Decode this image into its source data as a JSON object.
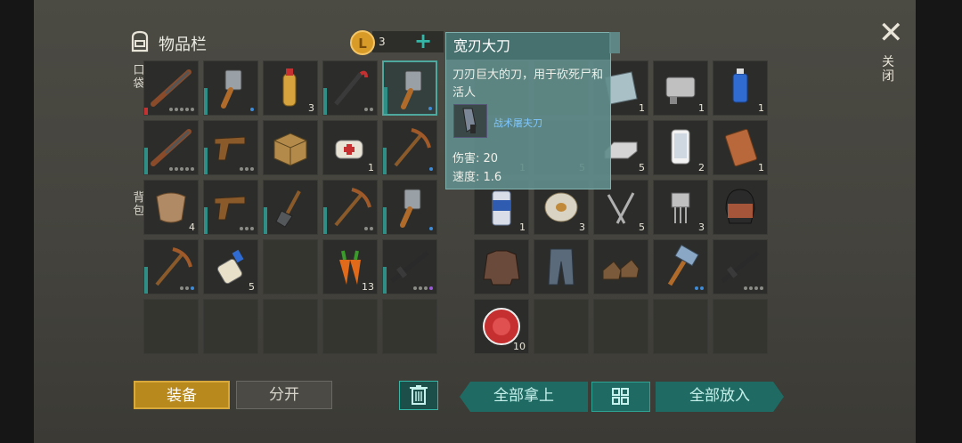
{
  "header": {
    "title": "物品栏",
    "coins": "3",
    "plus_label": "+"
  },
  "side_labels": {
    "pockets": "口袋",
    "backpack": "背包",
    "close": "关闭"
  },
  "close_icon": "✕",
  "colors": {
    "accent": "#35b7a7",
    "equip_gold": "#b88a1d",
    "durability_red": "#c43333"
  },
  "left_cells": [
    {
      "icon": "shotgun-icon",
      "count": "",
      "dots": "gray5",
      "bar": "red"
    },
    {
      "icon": "cleaver-icon",
      "count": "",
      "dots": "b1",
      "bar": "teal"
    },
    {
      "icon": "bottle-icon",
      "count": "3",
      "dots": "",
      "bar": "none"
    },
    {
      "icon": "crowbar-icon",
      "count": "",
      "dots": "gray2",
      "bar": "teal"
    },
    {
      "icon": "cleaver-icon",
      "count": "",
      "dots": "b1",
      "bar": "teal",
      "selected": true
    },
    {
      "icon": "shotgun-icon",
      "count": "",
      "dots": "gray5",
      "bar": "teal"
    },
    {
      "icon": "pistol-icon",
      "count": "",
      "dots": "gray3",
      "bar": "teal"
    },
    {
      "icon": "box-icon",
      "count": "",
      "dots": "",
      "bar": "none"
    },
    {
      "icon": "medkit-icon",
      "count": "1",
      "dots": "",
      "bar": "none"
    },
    {
      "icon": "pickaxe-icon",
      "count": "",
      "dots": "b1",
      "bar": "teal"
    },
    {
      "icon": "hide-icon",
      "count": "4",
      "dots": "",
      "bar": "none"
    },
    {
      "icon": "pistol-icon",
      "count": "",
      "dots": "gray3",
      "bar": "teal"
    },
    {
      "icon": "shovel-icon",
      "count": "",
      "dots": "",
      "bar": "teal"
    },
    {
      "icon": "pickaxe-icon",
      "count": "",
      "dots": "gray2",
      "bar": "teal"
    },
    {
      "icon": "cleaver-icon",
      "count": "",
      "dots": "b1",
      "bar": "teal"
    },
    {
      "icon": "pickaxe-icon",
      "count": "",
      "dots": "gray2b",
      "bar": "teal"
    },
    {
      "icon": "glue-icon",
      "count": "5",
      "dots": "",
      "bar": "none"
    },
    {
      "icon": "",
      "count": "",
      "dots": "",
      "bar": "none"
    },
    {
      "icon": "carrot-icon",
      "count": "13",
      "dots": "",
      "bar": "none"
    },
    {
      "icon": "rifle-icon",
      "count": "",
      "dots": "gray3p",
      "bar": "teal"
    },
    {
      "icon": "",
      "count": "",
      "dots": "",
      "bar": "none"
    },
    {
      "icon": "",
      "count": "",
      "dots": "",
      "bar": "none"
    },
    {
      "icon": "",
      "count": "",
      "dots": "",
      "bar": "none"
    },
    {
      "icon": "",
      "count": "",
      "dots": "",
      "bar": "none"
    },
    {
      "icon": "",
      "count": "",
      "dots": "",
      "bar": "none"
    }
  ],
  "right_cells": [
    {
      "icon": "",
      "count": ""
    },
    {
      "icon": "",
      "count": ""
    },
    {
      "icon": "glass-icon",
      "count": "1"
    },
    {
      "icon": "engine-icon",
      "count": "1"
    },
    {
      "icon": "spray-icon",
      "count": "1"
    },
    {
      "icon": "",
      "count": "1"
    },
    {
      "icon": "",
      "count": "5"
    },
    {
      "icon": "ingot-icon",
      "count": "5"
    },
    {
      "icon": "phone-icon",
      "count": "2"
    },
    {
      "icon": "diary-icon",
      "count": "1"
    },
    {
      "icon": "can-icon",
      "count": "1"
    },
    {
      "icon": "wire-icon",
      "count": "3"
    },
    {
      "icon": "nails-icon",
      "count": "5"
    },
    {
      "icon": "chip-icon",
      "count": "3"
    },
    {
      "icon": "helmet-icon",
      "count": ""
    },
    {
      "icon": "jacket-icon",
      "count": ""
    },
    {
      "icon": "pants-icon",
      "count": ""
    },
    {
      "icon": "boots-icon",
      "count": ""
    },
    {
      "icon": "hammer-icon",
      "count": "",
      "dots": "b2"
    },
    {
      "icon": "rifle-icon",
      "count": "",
      "dots": "gray4"
    },
    {
      "icon": "bottlecap-icon",
      "count": "10"
    },
    {
      "icon": "",
      "count": ""
    },
    {
      "icon": "",
      "count": ""
    },
    {
      "icon": "",
      "count": ""
    },
    {
      "icon": "",
      "count": ""
    }
  ],
  "tooltip": {
    "title": "宽刃大刀",
    "desc": "刀刃巨大的刀，用于砍死尸和活人",
    "related": "战术屠夫刀",
    "damage": "伤害: 20",
    "speed": "速度: 1.6"
  },
  "buttons": {
    "equip": "装备",
    "split": "分开",
    "take_all": "全部拿上",
    "put_all": "全部放入"
  }
}
